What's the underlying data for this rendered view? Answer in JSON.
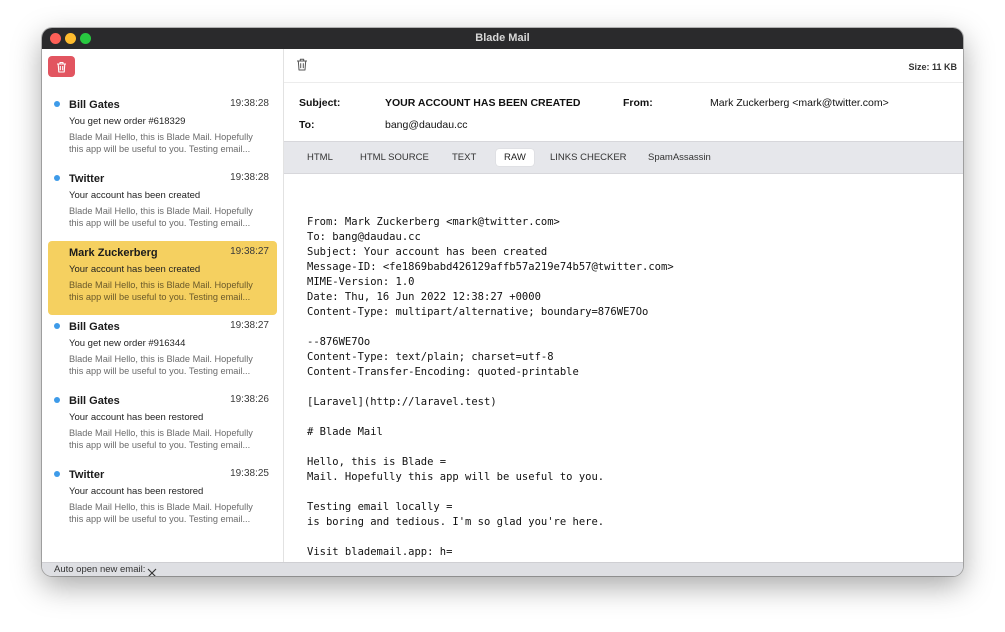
{
  "window": {
    "title": "Blade Mail"
  },
  "sidebar": {
    "delete_all_icon": "trash-icon",
    "emails": [
      {
        "sender": "Bill Gates",
        "time": "19:38:28",
        "subject": "You get new order #618329",
        "preview_line1": "Blade Mail Hello, this is Blade Mail. Hopefully",
        "preview_line2": "this app will be useful to you. Testing email...",
        "unread": true,
        "selected": false
      },
      {
        "sender": "Twitter",
        "time": "19:38:28",
        "subject": "Your account has been created",
        "preview_line1": "Blade Mail Hello, this is Blade Mail. Hopefully",
        "preview_line2": "this app will be useful to you. Testing email...",
        "unread": true,
        "selected": false
      },
      {
        "sender": "Mark Zuckerberg",
        "time": "19:38:27",
        "subject": "Your account has been created",
        "preview_line1": "Blade Mail Hello, this is Blade Mail. Hopefully",
        "preview_line2": "this app will be useful to you. Testing email...",
        "unread": false,
        "selected": true
      },
      {
        "sender": "Bill Gates",
        "time": "19:38:27",
        "subject": "You get new order #916344",
        "preview_line1": "Blade Mail Hello, this is Blade Mail. Hopefully",
        "preview_line2": "this app will be useful to you. Testing email...",
        "unread": true,
        "selected": false
      },
      {
        "sender": "Bill Gates",
        "time": "19:38:26",
        "subject": "Your account has been restored",
        "preview_line1": "Blade Mail Hello, this is Blade Mail. Hopefully",
        "preview_line2": "this app will be useful to you. Testing email...",
        "unread": true,
        "selected": false
      },
      {
        "sender": "Twitter",
        "time": "19:38:25",
        "subject": "Your account has been restored",
        "preview_line1": "Blade Mail Hello, this is Blade Mail. Hopefully",
        "preview_line2": "this app will be useful to you. Testing email...",
        "unread": true,
        "selected": false
      }
    ]
  },
  "statusbar": {
    "auto_open_label": "Auto open new email:",
    "auto_open_icon": "close-x-icon"
  },
  "toolbar": {
    "size_text": "Size: 11 KB",
    "delete_icon": "trash-icon"
  },
  "message": {
    "subject_label": "Subject:",
    "subject": "YOUR ACCOUNT HAS BEEN CREATED",
    "from_label": "From:",
    "from": "Mark Zuckerberg <mark@twitter.com>",
    "to_label": "To:",
    "to": "bang@daudau.cc"
  },
  "tabs": [
    {
      "label": "HTML",
      "active": false
    },
    {
      "label": "HTML SOURCE",
      "active": false
    },
    {
      "label": "TEXT",
      "active": false
    },
    {
      "label": "RAW",
      "active": true
    },
    {
      "label": "LINKS CHECKER",
      "active": false
    },
    {
      "label": "SpamAssassin",
      "active": false
    }
  ],
  "raw_content": "From: Mark Zuckerberg <mark@twitter.com>\nTo: bang@daudau.cc\nSubject: Your account has been created\nMessage-ID: <fe1869babd426129affb57a219e74b57@twitter.com>\nMIME-Version: 1.0\nDate: Thu, 16 Jun 2022 12:38:27 +0000\nContent-Type: multipart/alternative; boundary=876WE7Oo\n\n--876WE7Oo\nContent-Type: text/plain; charset=utf-8\nContent-Transfer-Encoding: quoted-printable\n\n[Laravel](http://laravel.test)\n\n# Blade Mail\n\nHello, this is Blade =\nMail. Hopefully this app will be useful to you.\n\nTesting email locally =\nis boring and tedious. I'm so glad you're here.\n\nVisit blademail.app: h=\nttps://blademail.app",
  "colors": {
    "selected_bg": "#f5d060",
    "unread_dot": "#3e9be9",
    "delete_button": "#e25560"
  }
}
